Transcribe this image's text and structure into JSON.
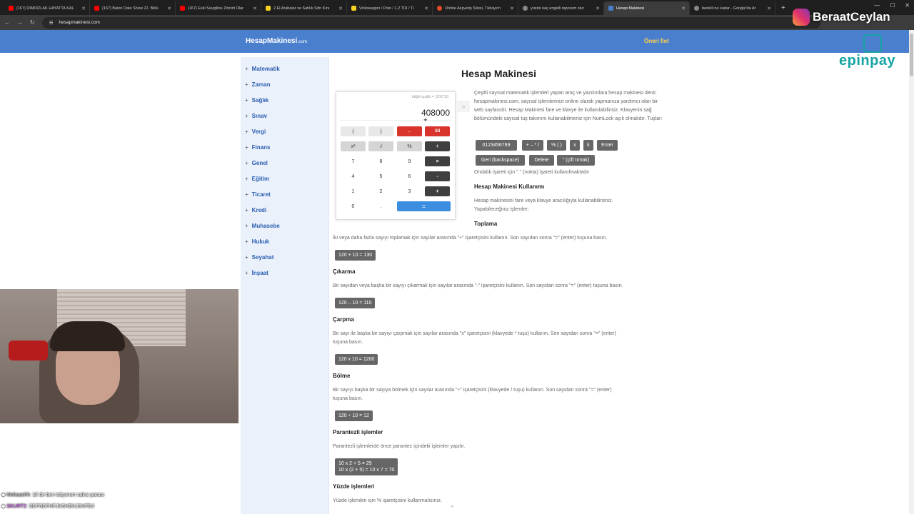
{
  "browser": {
    "tabs": [
      {
        "title": "(167) DIMDIZLAK HAYATTA KAL",
        "color": "#ff0000"
      },
      {
        "title": "(167) Balon Date Show 22. Bölü",
        "color": "#ff0000"
      },
      {
        "title": "(167) Eski Sevgiline Zincirli Olar",
        "color": "#ff0000"
      },
      {
        "title": "2.El Arabalar ve Satılık Sıfır Kını",
        "color": "#f5d21f"
      },
      {
        "title": "Volkswagen / Polo / 1.2 TDI / Tı",
        "color": "#f5d21f"
      },
      {
        "title": "Online Alışveriş Sitesi, Türkiye'n",
        "color": "#e44d26"
      },
      {
        "title": "yüzde kaç engelli raporum olur",
        "color": "#888888"
      },
      {
        "title": "Hesap Makinesi",
        "color": "#4a7fce",
        "active": true
      },
      {
        "title": "bedelli ne kadar - Google'da Ar",
        "color": "#888888"
      }
    ],
    "url": "hesapmakinesi.com"
  },
  "site": {
    "logo_main": "HesapMakinesi",
    "logo_suffix": ".com",
    "oneri": "Öneri İlet",
    "categories": [
      "Matematik",
      "Zaman",
      "Sağlık",
      "Sınav",
      "Vergi",
      "Finans",
      "Genel",
      "Eğitim",
      "Ticaret",
      "Kredi",
      "Muhasebe",
      "Hukuk",
      "Seyahat",
      "İnşaat"
    ],
    "page_title": "Hesap Makinesi"
  },
  "calculator": {
    "history": "kâğıt quâƙi = 326710",
    "display": "408000",
    "keys": {
      "lparen": "(",
      "rparen": ")",
      "back": "←",
      "clear": "Sil",
      "square": "x²",
      "sqrt": "√",
      "percent": "%",
      "divide": "÷",
      "d7": "7",
      "d8": "8",
      "d9": "9",
      "multiply": "×",
      "d4": "4",
      "d5": "5",
      "d6": "6",
      "minus": "-",
      "d1": "1",
      "d2": "2",
      "d3": "3",
      "plus": "+",
      "d0": "0",
      "dot": ".",
      "equals": "="
    }
  },
  "content": {
    "intro": "Çeşitli sayısal matematik işlemleri yapan araç ve yazılımlara hesap makinesi denir. hesapmakinesi.com, sayısal işlemlerinizi online olarak yapmanıza yardımcı olan bir web sayfasıdır. Hesap Makinesi fare ve klavye ile kullanılabilinsiz. Klavyenin sağ bölümündeki sayısal tuş takımını kullanabilmeniz için NumLock açık olmalıdır. Tuşlar:",
    "keyboard_keys": {
      "digits": "0123456789",
      "ops": "+ – * /",
      "percent_paren": "% ( )",
      "x": "x",
      "k": "k",
      "enter": "Enter",
      "backspace": "Geri (backspace)",
      "delete": "Delete",
      "quote": "\" (çift tırnak)"
    },
    "decimal_note": "Ondalık işareti için \".\" (nokta) işareti kullanılmaktadır",
    "usage_title": "Hesap Makinesi Kullanımı",
    "usage_text": "Hesap makinesini fare veya klavye aracılığıyla kullanabilirsiniz. Yapabileceğiniz işlemler;",
    "toplama_title": "Toplama",
    "toplama_text": "İki veya daha fazla sayıyı toplamak için sayılar arasında \"+\" işaretçisini kullanın. Son sayıdan sonra \"=\" (enter) tuşuna basın.",
    "toplama_ex": "120 + 10 = 130",
    "cikarma_title": "Çıkarma",
    "cikarma_text": "Bir sayıdan veya başka bir sayıyı çıkarmak için sayılar arasında \"-\" işaretçisini kullanın. Son sayıdan sonra \"=\" (enter) tuşuna basın.",
    "cikarma_ex": "120 – 10 = 110",
    "carpma_title": "Çarpma",
    "carpma_text1": "Bir sayı ile başka bir sayıyı çarpmak için sayılar arasında \"x\" işaretçisini (klavyede * tuşu) kullanın. Son sayıdan sonra \"=\" (enter)",
    "carpma_text2": "tuşuna basın.",
    "carpma_ex": "120 x 10 = 1200",
    "bolme_title": "Bölme",
    "bolme_text1": "Bir sayıyı başka bir sayıya bölmek için sayılar arasında \"÷\" işaretçisini (klavyede / tuşu) kullanın. Son sayıdan sonra \"=\" (enter)",
    "bolme_text2": "tuşuna basın.",
    "bolme_ex": "120 ÷ 10 = 12",
    "paren_title": "Parantezli işlemler",
    "paren_text": "Parantezli işlemlerde önce parantez içindeki işlemler yapılır.",
    "paren_ex1": "10 x 2 + 5 = 25",
    "paren_ex2": "10 x (2 + 5) = 10 x 7 = 70",
    "yuzde_title": "Yüzde işlemleri",
    "yuzde_text": "Yüzde işlemleri için % işaretçisini kullanmalısınız."
  },
  "overlay": {
    "instagram": "BeraatCeylan",
    "sponsor": "epinpay",
    "chat": [
      {
        "user": "Mokaashh",
        "msg": ": 1tl de ben istiyorum sakız parası"
      },
      {
        "user": "SKURT2",
        "msg": ": SDFSDFHFJKSHDKJSHFDJ"
      }
    ]
  }
}
